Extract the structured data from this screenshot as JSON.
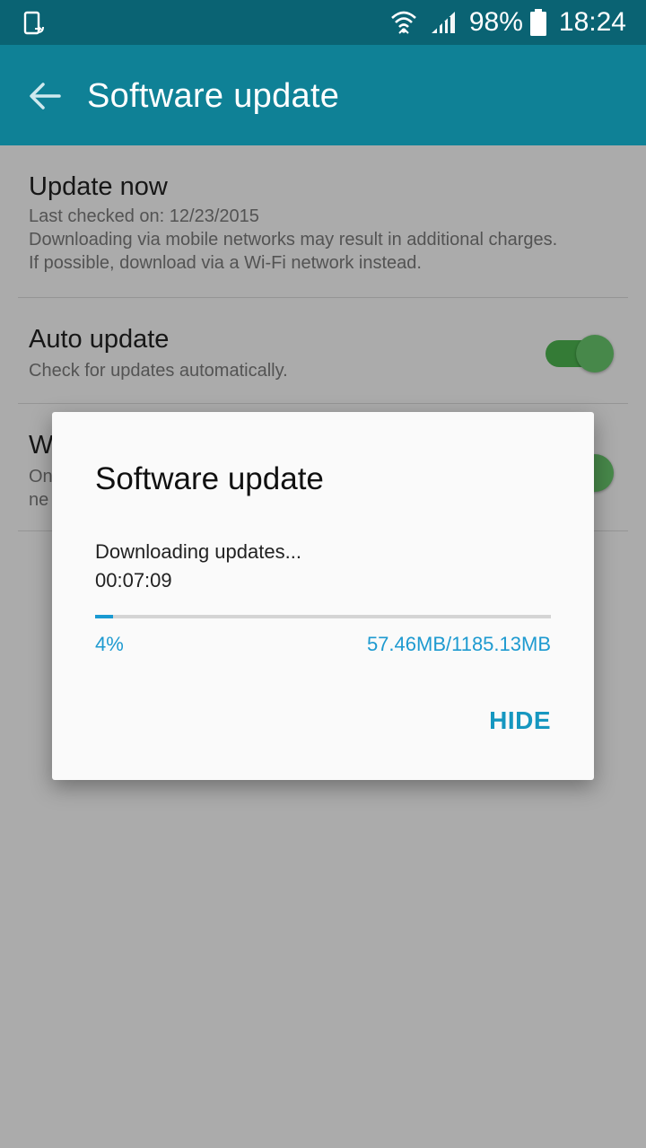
{
  "status_bar": {
    "battery_percent": "98%",
    "time": "18:24",
    "icons": [
      "phone-sync-icon",
      "wifi-icon",
      "signal-icon",
      "battery-icon"
    ]
  },
  "app_bar": {
    "title": "Software update",
    "back_icon": "back-arrow-icon"
  },
  "settings": {
    "update_now": {
      "title": "Update now",
      "last_checked": "Last checked on: 12/23/2015",
      "note": "Downloading via mobile networks may result in additional charges. If possible, download via a Wi-Fi network instead."
    },
    "auto_update": {
      "title": "Auto update",
      "subtitle": "Check for updates automatically.",
      "enabled": true
    },
    "wifi_only": {
      "title_fragment": "W",
      "sub_fragment_1": "On",
      "sub_fragment_2": "ne",
      "enabled": true
    }
  },
  "dialog": {
    "title": "Software update",
    "status": "Downloading updates...",
    "elapsed": "00:07:09",
    "percent_label": "4%",
    "progress_fraction": 0.04,
    "size_label": "57.46MB/1185.13MB",
    "hide_label": "HIDE"
  },
  "colors": {
    "status_bar": "#0a6373",
    "app_bar": "#0f8196",
    "accent": "#1e9ad0",
    "toggle_on": "#4bb14e"
  }
}
